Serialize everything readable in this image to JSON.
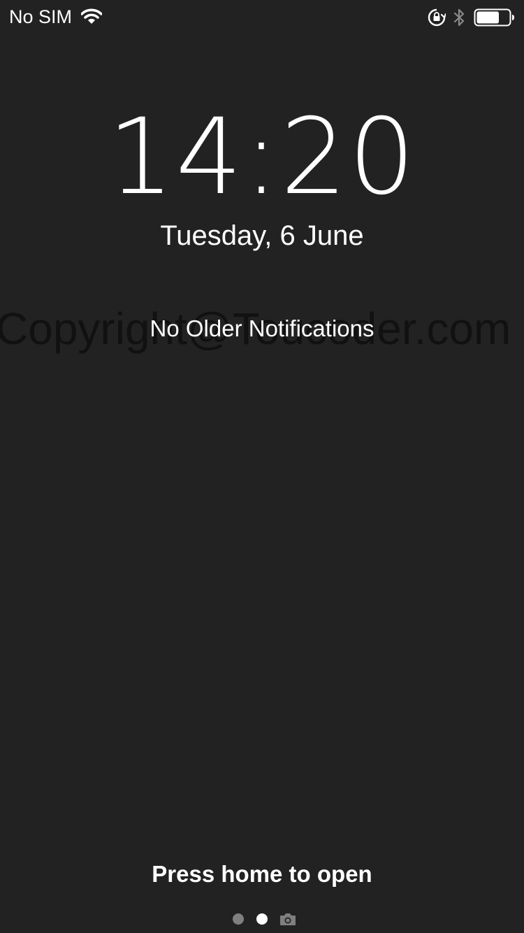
{
  "status_bar": {
    "carrier": "No SIM",
    "icons": [
      "wifi-icon",
      "rotation-lock-icon",
      "bluetooth-icon",
      "battery-icon"
    ],
    "battery_level": 0.7
  },
  "lock_screen": {
    "time": "14:20",
    "date": "Tuesday, 6 June",
    "notifications_text": "No Older Notifications",
    "watermark": "Copyright@Toucoder.com",
    "unlock_hint": "Press home to open"
  },
  "page_indicator": {
    "page_count": 2,
    "current_page": 2,
    "trailing_icon": "camera-icon"
  },
  "colors": {
    "background": "#222222",
    "text": "#ffffff",
    "dot_inactive": "#7f7f7f",
    "watermark": "#111111"
  }
}
